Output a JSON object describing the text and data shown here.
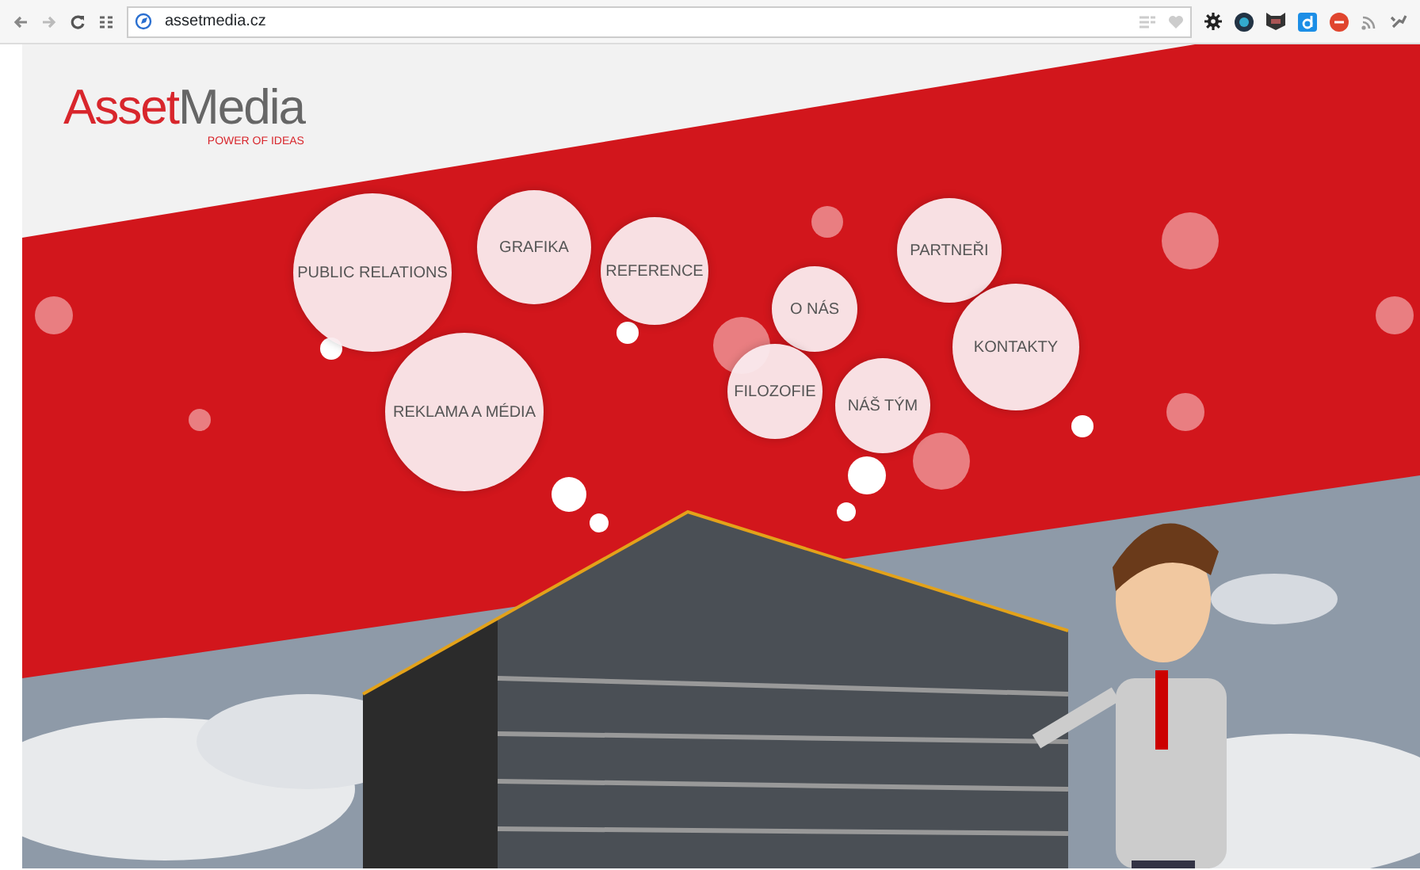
{
  "browser": {
    "url": "assetmedia.cz"
  },
  "logo": {
    "word_1": "Asset",
    "word_2": "Media",
    "tagline": "POWER OF IDEAS"
  },
  "menu": [
    {
      "label": "PUBLIC RELATIONS"
    },
    {
      "label": "GRAFIKA"
    },
    {
      "label": "REFERENCE"
    },
    {
      "label": "PARTNEŘI"
    },
    {
      "label": "O NÁS"
    },
    {
      "label": "KONTAKTY"
    },
    {
      "label": "FILOZOFIE"
    },
    {
      "label": "NÁŠ TÝM"
    },
    {
      "label": "REKLAMA A MÉDIA"
    }
  ]
}
